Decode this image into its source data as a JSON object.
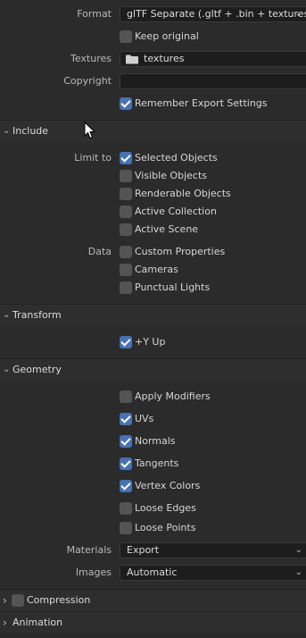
{
  "export": {
    "format_label": "Format",
    "format_value": "glTF Separate (.gltf + .bin + textures)",
    "keep_original_label": "Keep original",
    "keep_original": false,
    "textures_label": "Textures",
    "textures_value": "textures",
    "copyright_label": "Copyright",
    "copyright_value": "",
    "remember_label": "Remember Export Settings",
    "remember": true
  },
  "include": {
    "title": "Include",
    "limit_to_label": "Limit to",
    "limit_to": [
      {
        "label": "Selected Objects",
        "checked": true
      },
      {
        "label": "Visible Objects",
        "checked": false
      },
      {
        "label": "Renderable Objects",
        "checked": false
      },
      {
        "label": "Active Collection",
        "checked": false
      },
      {
        "label": "Active Scene",
        "checked": false
      }
    ],
    "data_label": "Data",
    "data": [
      {
        "label": "Custom Properties",
        "checked": false
      },
      {
        "label": "Cameras",
        "checked": false
      },
      {
        "label": "Punctual Lights",
        "checked": false
      }
    ]
  },
  "transform": {
    "title": "Transform",
    "y_up_label": "+Y Up",
    "y_up": true
  },
  "geometry": {
    "title": "Geometry",
    "options": [
      {
        "label": "Apply Modifiers",
        "checked": false
      },
      {
        "label": "UVs",
        "checked": true
      },
      {
        "label": "Normals",
        "checked": true
      },
      {
        "label": "Tangents",
        "checked": true
      },
      {
        "label": "Vertex Colors",
        "checked": true
      },
      {
        "label": "Loose Edges",
        "checked": false
      },
      {
        "label": "Loose Points",
        "checked": false
      }
    ],
    "materials_label": "Materials",
    "materials_value": "Export",
    "images_label": "Images",
    "images_value": "Automatic"
  },
  "compression": {
    "title": "Compression",
    "enabled": false
  },
  "animation": {
    "title": "Animation"
  },
  "colors": {
    "accent": "#4772b3",
    "panel": "#2b2b2b",
    "field": "#1d1d1d"
  }
}
